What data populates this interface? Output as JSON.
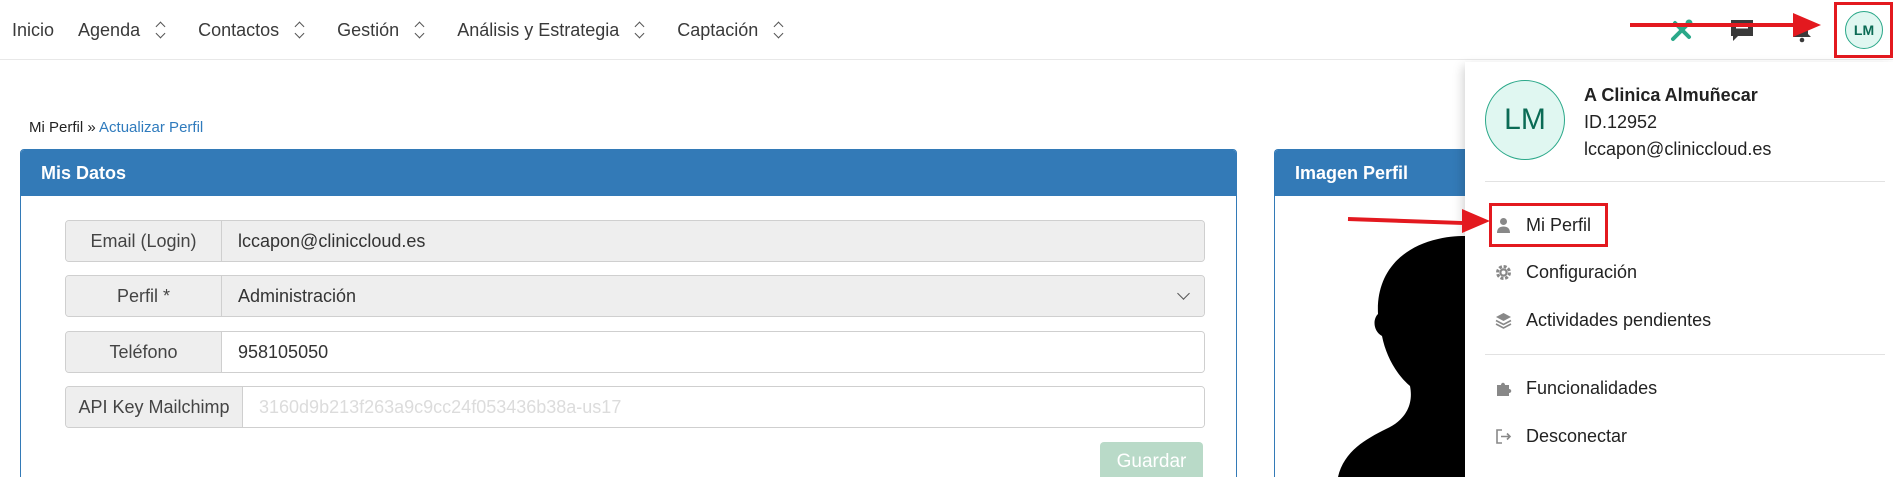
{
  "nav": {
    "items": [
      {
        "label": "Inicio",
        "has_menu": false
      },
      {
        "label": "Agenda",
        "has_menu": true
      },
      {
        "label": "Contactos",
        "has_menu": true
      },
      {
        "label": "Gestión",
        "has_menu": true
      },
      {
        "label": "Análisis y Estrategia",
        "has_menu": true
      },
      {
        "label": "Captación",
        "has_menu": true
      }
    ],
    "icons": [
      "tools-icon",
      "chat-icon",
      "bell-icon"
    ],
    "user_initials": "LM"
  },
  "breadcrumb": {
    "current": "Mi Perfil",
    "separator": "»",
    "link": "Actualizar Perfil"
  },
  "mis_datos": {
    "title": "Mis Datos",
    "email_label": "Email (Login)",
    "email_value": "lccapon@cliniccloud.es",
    "perfil_label": "Perfil *",
    "perfil_value": "Administración",
    "telefono_label": "Teléfono",
    "telefono_value": "958105050",
    "api_label": "API Key Mailchimp",
    "api_value": "3160d9b213f263a9c9cc24f053436b38a-us17",
    "save_label": "Guardar"
  },
  "imagen_perfil": {
    "title": "Imagen Perfil"
  },
  "user_menu": {
    "initials": "LM",
    "name": "A Clinica Almuñecar",
    "id": "ID.12952",
    "email": "lccapon@cliniccloud.es",
    "items": [
      {
        "label": "Mi Perfil",
        "icon": "user-icon"
      },
      {
        "label": "Configuración",
        "icon": "gear-icon"
      },
      {
        "label": "Actividades pendientes",
        "icon": "layers-icon"
      },
      {
        "label": "Funcionalidades",
        "icon": "puzzle-icon"
      },
      {
        "label": "Desconectar",
        "icon": "logout-icon"
      }
    ]
  },
  "colors": {
    "primary": "#337ab7",
    "accent": "#2aa889",
    "annotation": "#e3191f"
  }
}
